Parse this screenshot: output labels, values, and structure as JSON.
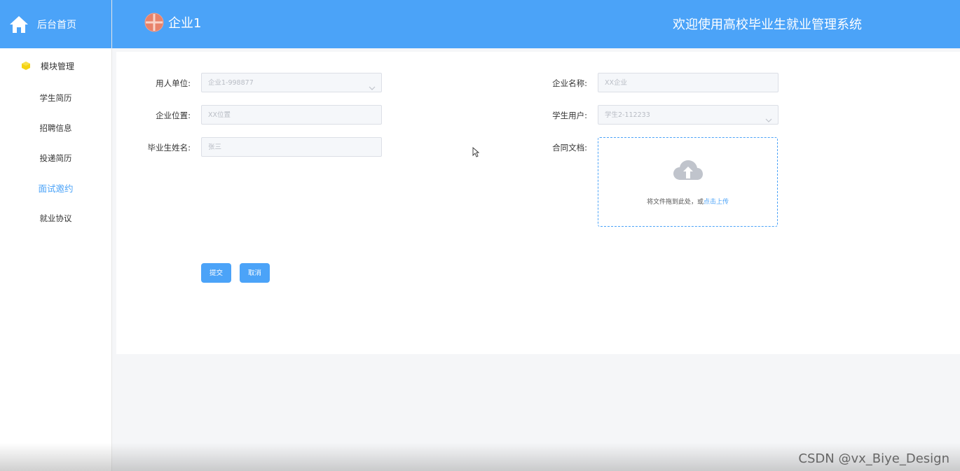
{
  "sidebar": {
    "home_label": "后台首页",
    "group_label": "模块管理",
    "items": [
      {
        "label": "学生简历"
      },
      {
        "label": "招聘信息"
      },
      {
        "label": "投递简历"
      },
      {
        "label": "面试邀约",
        "active": true
      },
      {
        "label": "就业协议"
      }
    ]
  },
  "header": {
    "brand_name": "企业1",
    "welcome": "欢迎使用高校毕业生就业管理系统",
    "accent_color": "#4ba3f8"
  },
  "form": {
    "employer_label": "用人单位:",
    "employer_value": "企业1-998877",
    "location_label": "企业位置:",
    "location_placeholder": "XX位置",
    "graduate_label": "毕业生姓名:",
    "graduate_placeholder": "张三",
    "company_label": "企业名称:",
    "company_placeholder": "XX企业",
    "student_label": "学生用户:",
    "student_value": "学生2-112233",
    "contract_label": "合同文档:",
    "upload_text": "将文件拖到此处，或",
    "upload_link": "点击上传",
    "submit_label": "提交",
    "cancel_label": "取消"
  },
  "watermark": "CSDN @vx_Biye_Design"
}
